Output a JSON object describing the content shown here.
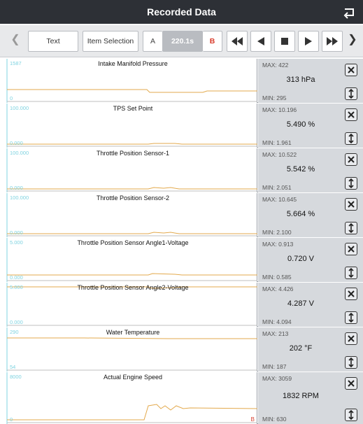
{
  "header": {
    "title": "Recorded Data",
    "back_icon": "return-icon"
  },
  "toolbar": {
    "text_label": "Text",
    "item_selection_label": "Item Selection",
    "a_label": "A",
    "time_value": "220.1s",
    "b_label": "B"
  },
  "colors": {
    "trace": "#e3a94c",
    "axis_label": "#7fd3e0",
    "titlebar": "#2d3036",
    "info_bg": "#d6d9dd"
  },
  "rows": [
    {
      "name": "Intake Manifold Pressure",
      "axis_max": "1587",
      "axis_min": "0",
      "max": "MAX: 422",
      "current": "313 hPa",
      "min": "MIN: 295"
    },
    {
      "name": "TPS Set Point",
      "axis_max": "100.000",
      "axis_min": "0.000",
      "max": "MAX: 10.196",
      "current": "5.490 %",
      "min": "MIN: 1.961"
    },
    {
      "name": "Throttle Position Sensor-1",
      "axis_max": "100.000",
      "axis_min": "0.000",
      "max": "MAX: 10.522",
      "current": "5.542 %",
      "min": "MIN: 2.051"
    },
    {
      "name": "Throttle Position Sensor-2",
      "axis_max": "100.000",
      "axis_min": "0.000",
      "max": "MAX: 10.645",
      "current": "5.664 %",
      "min": "MIN: 2.100"
    },
    {
      "name": "Throttle Position Sensor Angle1-Voltage",
      "axis_max": "5.000",
      "axis_min": "0.000",
      "max": "MAX: 0.913",
      "current": "0.720 V",
      "min": "MIN: 0.585"
    },
    {
      "name": "Throttle Position Sensor Angle2-Voltage",
      "axis_max": "5.000",
      "axis_min": "0.000",
      "max": "MAX: 4.426",
      "current": "4.287 V",
      "min": "MIN: 4.094"
    },
    {
      "name": "Water Temperature",
      "axis_max": "290",
      "axis_min": "54",
      "max": "MAX: 213",
      "current": "202 °F",
      "min": "MIN: 187"
    },
    {
      "name": "Actual Engine Speed",
      "axis_max": "8000",
      "axis_min": "0",
      "max": "MAX: 3059",
      "current": "1832 RPM",
      "min": "MIN: 630",
      "b_marker": "B"
    }
  ]
}
